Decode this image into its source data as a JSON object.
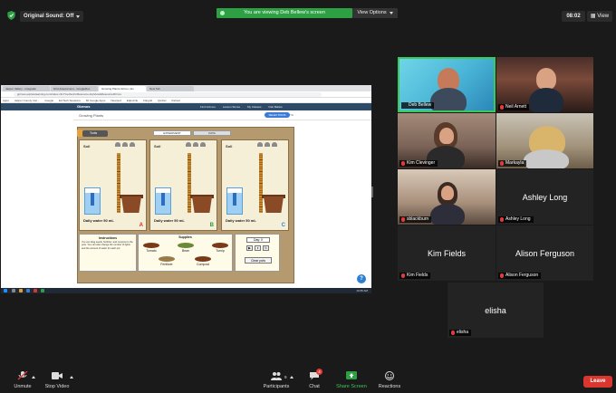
{
  "top_bar": {
    "sound_label": "Original Sound: Off",
    "banner_text": "You are viewing Deb Bellew's screen",
    "view_options_label": "View Options",
    "clock": "08:02",
    "view_label": "View"
  },
  "shared_screen": {
    "browser_tabs": [
      "Jasper Vallery - Integratio",
      "Grid Assessment - GoogleDoc",
      "Growing Plants Gizmo | Ex",
      "New Tab"
    ],
    "url": "gizmos.explorelearning.com/index.cfm?method=cResource.dspView&ResourceID=xxx",
    "bookmarks": [
      "Apps",
      "Jasper County Inst...",
      "Google",
      "Ed Tech Sessions",
      "Mr Google Apps",
      "Nearpod",
      "Edpuzzle",
      "Flipgrid",
      "Quizlet",
      "Kahoot"
    ],
    "gizmo_brand": "Gizmos",
    "gizmo_menu": [
      "Find Gizmos",
      "Lesson Stores",
      "My Classes",
      "Deb Bellew"
    ],
    "gizmo_title": "Growing Plants",
    "gizmo_sub_right": [
      "LAUNCH",
      "FAVORITE"
    ],
    "save_label": "SELECTIONS",
    "tools_label": "Tools",
    "sim_tabs": [
      "EXPERIMENT",
      "DATA"
    ],
    "plots": [
      {
        "soil": "Soil",
        "water": "Daily water  50  mL",
        "letter": "A",
        "color": "#d62b2b"
      },
      {
        "soil": "Soil",
        "water": "Daily water  50  mL",
        "letter": "B",
        "color": "#2c9a3a"
      },
      {
        "soil": "Soil",
        "water": "Daily water  50  mL",
        "letter": "C",
        "color": "#3b80c9"
      }
    ],
    "instructions_title": "Instructions",
    "instructions_text": "You can drag seeds, fertilizer, and compost to the pots. You can also change the number of lights and the amount of water for each pot.",
    "supplies_title": "Supplies",
    "supplies": [
      "Tomato",
      "Bean",
      "Turnip",
      "Fertilizer",
      "Compost"
    ],
    "day_label": "Day: 0",
    "control_buttons": [
      "▶",
      "⏸",
      "↻"
    ],
    "clear_label": "Clear pots",
    "help_label": "?",
    "taskbar_clock": "10:35 AM"
  },
  "participants": [
    {
      "name": "Deb Bellew",
      "muted": false,
      "active": true
    },
    {
      "name": "Neil Arnett",
      "muted": true,
      "active": false
    },
    {
      "name": "Kim Clevinger",
      "muted": true,
      "active": false
    },
    {
      "name": "Markayla",
      "muted": true,
      "active": false
    },
    {
      "name": "sblackburn",
      "muted": true,
      "active": false
    },
    {
      "name": "Ashley Long",
      "muted": true,
      "active": false,
      "video_off": true
    },
    {
      "name": "Kim Fields",
      "muted": true,
      "active": false,
      "video_off": true
    },
    {
      "name": "Alison Ferguson",
      "muted": true,
      "active": false,
      "video_off": true
    },
    {
      "name": "elisha",
      "muted": true,
      "active": false,
      "video_off": true
    }
  ],
  "toolbar": {
    "unmute": "Unmute",
    "stop_video": "Stop Video",
    "participants": "Participants",
    "participants_count": "9",
    "chat": "Chat",
    "chat_badge": "4",
    "share_screen": "Share Screen",
    "reactions": "Reactions",
    "leave": "Leave"
  },
  "colors": {
    "active_speaker": "#3bc95b",
    "leave": "#d9362f",
    "banner": "#2ea044",
    "share_icon": "#2ea044"
  }
}
